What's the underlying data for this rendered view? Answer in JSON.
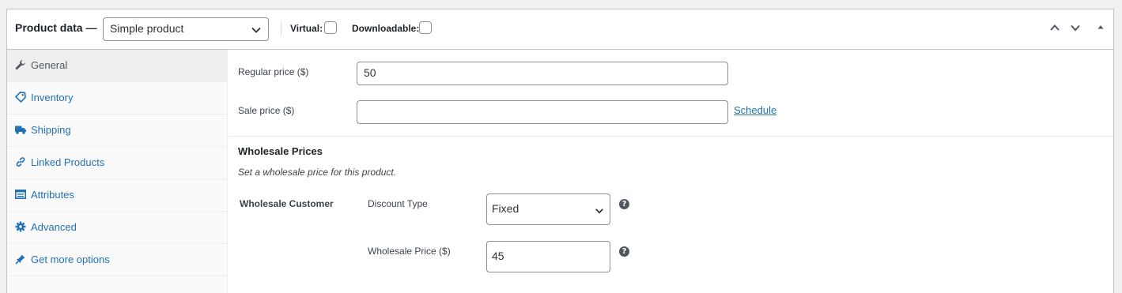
{
  "header": {
    "title": "Product data —",
    "product_type": "Simple product",
    "virtual_label": "Virtual:",
    "downloadable_label": "Downloadable:",
    "virtual_checked": false,
    "downloadable_checked": false
  },
  "sidebar": {
    "items": [
      {
        "label": "General",
        "icon": "wrench-icon",
        "active": true
      },
      {
        "label": "Inventory",
        "icon": "tag-icon",
        "active": false
      },
      {
        "label": "Shipping",
        "icon": "truck-icon",
        "active": false
      },
      {
        "label": "Linked Products",
        "icon": "link-icon",
        "active": false
      },
      {
        "label": "Attributes",
        "icon": "list-icon",
        "active": false
      },
      {
        "label": "Advanced",
        "icon": "gear-icon",
        "active": false
      },
      {
        "label": "Get more options",
        "icon": "plugin-icon",
        "active": false
      }
    ]
  },
  "general": {
    "regular_price_label": "Regular price ($)",
    "regular_price_value": "50",
    "sale_price_label": "Sale price ($)",
    "sale_price_value": "",
    "schedule_link": "Schedule"
  },
  "wholesale": {
    "title": "Wholesale Prices",
    "description": "Set a wholesale price for this product.",
    "role_label": "Wholesale Customer",
    "discount_type_label": "Discount Type",
    "discount_type_value": "Fixed",
    "price_label": "Wholesale Price ($)",
    "price_value": "45"
  },
  "colors": {
    "link": "#2271b1",
    "border": "#c3c4c7",
    "sidebar_bg": "#fafafa",
    "active_tab_bg": "#eeeeee"
  }
}
